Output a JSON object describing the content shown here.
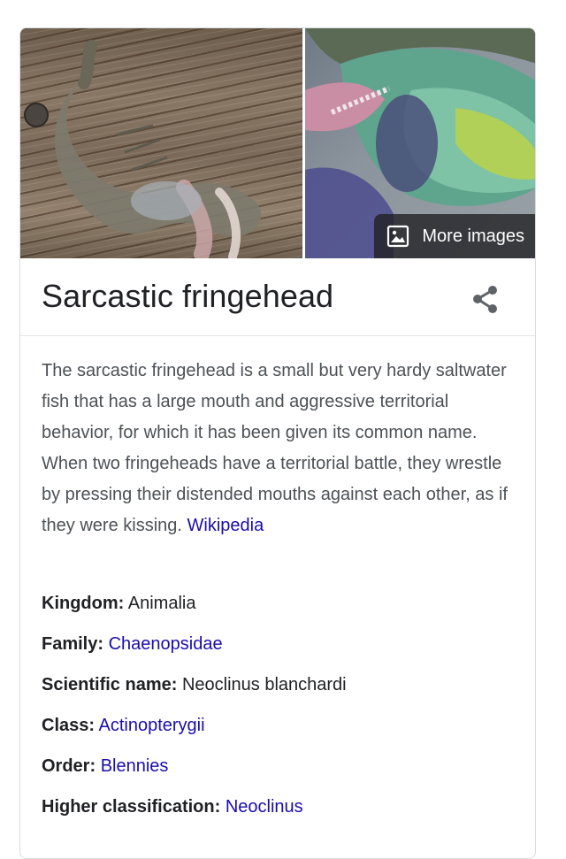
{
  "images": {
    "left_icon": "fringehead-photo",
    "right_icon": "fringehead-mouth-photo",
    "more_images_label": "More images",
    "more_images_icon": "image-icon"
  },
  "header": {
    "title": "Sarcastic fringehead",
    "share_icon": "share-icon"
  },
  "description": {
    "text": "The sarcastic fringehead is a small but very hardy saltwater fish that has a large mouth and aggressive territorial behavior, for which it has been given its common name. When two fringeheads have a territorial battle, they wrestle by pressing their distended mouths against each other, as if they were kissing.",
    "source_link": "Wikipedia"
  },
  "facts": [
    {
      "label": "Kingdom:",
      "value": "Animalia",
      "is_link": false
    },
    {
      "label": "Family:",
      "value": "Chaenopsidae",
      "is_link": true
    },
    {
      "label": "Scientific name:",
      "value": "Neoclinus blanchardi",
      "is_link": false
    },
    {
      "label": "Class:",
      "value": "Actinopterygii",
      "is_link": true
    },
    {
      "label": "Order:",
      "value": "Blennies",
      "is_link": true
    },
    {
      "label": "Higher classification:",
      "value": "Neoclinus",
      "is_link": true
    }
  ],
  "colors": {
    "link": "#1a0dab",
    "title": "#202124",
    "body_text": "#4d5156",
    "divider": "#e3e5e8"
  }
}
